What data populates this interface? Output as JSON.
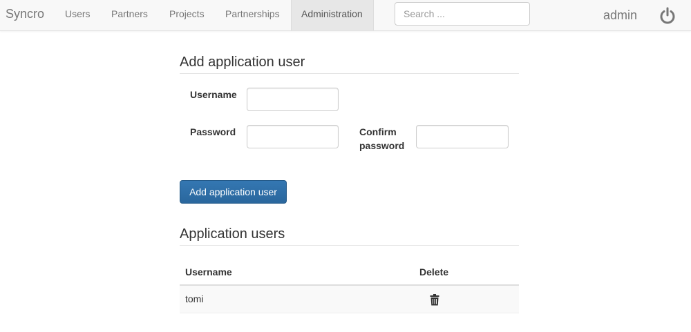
{
  "nav": {
    "brand": "Syncro",
    "items": [
      "Users",
      "Partners",
      "Projects",
      "Partnerships",
      "Administration"
    ],
    "active": "Administration",
    "search_placeholder": "Search ...",
    "user": "admin",
    "power_icon": "power-icon"
  },
  "add_user": {
    "heading": "Add application user",
    "username_label": "Username",
    "password_label": "Password",
    "confirm_label_line1": "Confirm",
    "confirm_label_line2": "password",
    "username_value": "",
    "password_value": "",
    "confirm_value": "",
    "submit_label": "Add application user"
  },
  "users_list": {
    "heading": "Application users",
    "columns": [
      "Username",
      "Delete"
    ],
    "rows": [
      {
        "username": "tomi",
        "delete_icon": "trash-icon"
      }
    ]
  },
  "colors": {
    "primary_button": "#2f6ea5",
    "navbar_bg": "#f8f8f8",
    "active_tab_bg": "#e7e7e7"
  }
}
